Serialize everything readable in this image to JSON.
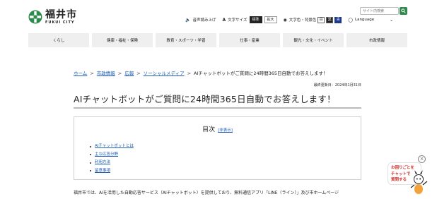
{
  "header": {
    "logo_jp": "福井市",
    "logo_en": "FUKUI CITY",
    "util": {
      "read_aloud": "音声読み上げ",
      "font_size_label": "文字サイズ",
      "font_standard": "標準",
      "font_large": "拡大",
      "color_label": "文字色・背景色",
      "color_chips": [
        "白",
        "黒",
        "青"
      ],
      "language": "Language"
    },
    "search": {
      "placeholder": "サイト内検索"
    }
  },
  "nav": {
    "items": [
      "くらし",
      "健康・福祉・保険",
      "教育・スポーツ・学習",
      "仕事・産業",
      "観光・文化・イベント",
      "市政情報"
    ]
  },
  "breadcrumb": {
    "items": [
      "ホーム",
      "市政情報",
      "広報",
      "ソーシャルメディア"
    ],
    "separator": ">",
    "current": "AIチャットボットがご質問に24時間365日自動でお答えします！"
  },
  "main": {
    "updated": "最終更新日：2024年1月31日",
    "title": "AIチャットボットがご質問に24時間365日自動でお答えします！",
    "toc": {
      "heading": "目次",
      "toggle": "[非表示]",
      "items": [
        "AIチャットボットとは",
        "主な応答分野",
        "利用方法",
        "留意事項"
      ]
    },
    "intro": "福井市では、AIを活用した自動応答サービス（AIチャットボット）を提供しており、無料通信アプリ「LINE（ライン）」及び市ホームページ"
  },
  "chatbot": {
    "bubble_lines": [
      "お困りごとを",
      "チャットで",
      "質問する"
    ],
    "close": "×"
  },
  "colors": {
    "accent_green": "#2f8a4e",
    "link": "#1a5bb0",
    "bot_text": "#d2302a"
  }
}
